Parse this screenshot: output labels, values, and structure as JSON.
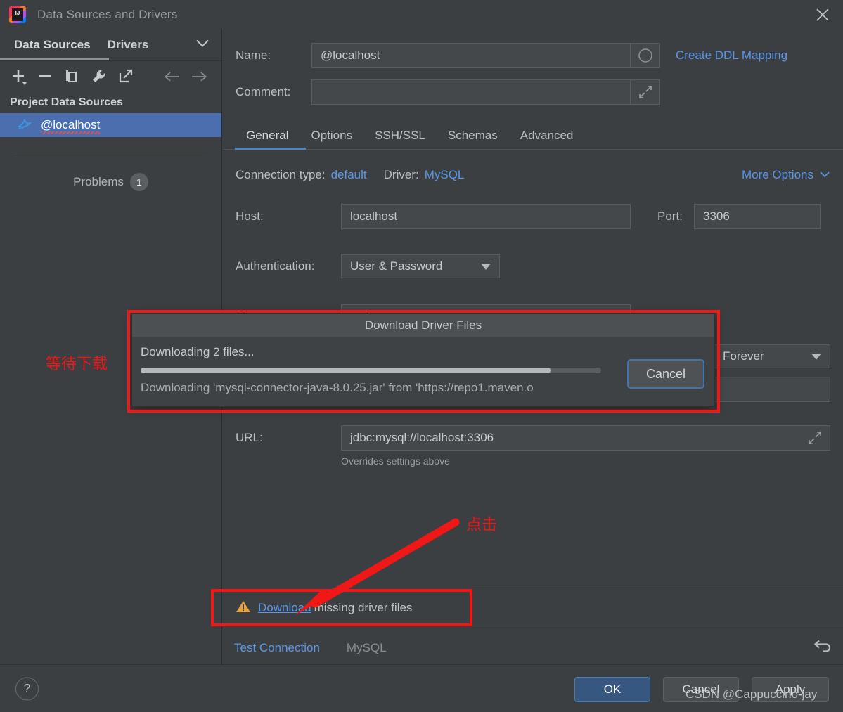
{
  "window": {
    "title": "Data Sources and Drivers",
    "logo_icon": "intellij-idea-logo",
    "close_icon": "close-icon"
  },
  "sidebar": {
    "tabs": [
      {
        "label": "Data Sources",
        "active": true
      },
      {
        "label": "Drivers",
        "active": false
      }
    ],
    "expand_icon": "chevron-down-icon",
    "toolbar": [
      {
        "icon": "add-icon",
        "label": "Add"
      },
      {
        "icon": "remove-icon",
        "label": "Remove"
      },
      {
        "icon": "copy-icon",
        "label": "Duplicate"
      },
      {
        "icon": "wrench-icon",
        "label": "Properties"
      },
      {
        "icon": "external-link-icon",
        "label": "Open"
      },
      {
        "icon": "arrow-left-icon",
        "label": "Back"
      },
      {
        "icon": "arrow-right-icon",
        "label": "Forward"
      }
    ],
    "section_title": "Project Data Sources",
    "data_source": {
      "label": "@localhost",
      "icon": "mysql-dolphin-icon",
      "selected": true
    },
    "problems": {
      "label": "Problems",
      "count": "1"
    }
  },
  "main": {
    "name": {
      "label": "Name:",
      "value": "@localhost",
      "color_icon": "color-circle-icon"
    },
    "comment": {
      "label": "Comment:",
      "value": "",
      "expand_icon": "expand-icon"
    },
    "create_ddl_mapping": "Create DDL Mapping",
    "tabs": [
      {
        "label": "General",
        "active": true
      },
      {
        "label": "Options",
        "active": false
      },
      {
        "label": "SSH/SSL",
        "active": false
      },
      {
        "label": "Schemas",
        "active": false
      },
      {
        "label": "Advanced",
        "active": false
      }
    ],
    "connection_type": {
      "label": "Connection type:",
      "value": "default"
    },
    "driver": {
      "label": "Driver:",
      "value": "MySQL"
    },
    "more_options": {
      "label": "More Options",
      "icon": "chevron-down-icon"
    },
    "host": {
      "label": "Host:",
      "value": "localhost"
    },
    "port": {
      "label": "Port:",
      "value": "3306"
    },
    "authentication": {
      "label": "Authentication:",
      "value": "User & Password",
      "caret_icon": "caret-down-icon"
    },
    "user": {
      "label": "User:",
      "value": "root"
    },
    "save": {
      "value": "Forever",
      "caret_icon": "caret-down-icon"
    },
    "password": {
      "value": ""
    },
    "url": {
      "label": "URL:",
      "value": "jdbc:mysql://localhost:3306",
      "expand_icon": "expand-icon",
      "hint": "Overrides settings above"
    },
    "driver_warning": {
      "icon": "warning-triangle-icon",
      "link_text": "Download",
      "rest_text": " missing driver files"
    },
    "test_connection": "Test Connection",
    "driver_name": "MySQL",
    "revert_icon": "revert-arrow-icon"
  },
  "download_dialog": {
    "title": "Download Driver Files",
    "status": "Downloading 2 files...",
    "progress_percent": 89,
    "detail": "Downloading 'mysql-connector-java-8.0.25.jar' from 'https://repo1.maven.o",
    "cancel_label": "Cancel"
  },
  "footer": {
    "help_icon": "question-mark-icon",
    "ok_label": "OK",
    "cancel_label": "Cancel",
    "apply_label": "Apply"
  },
  "annotations": {
    "wait_download": "等待下载",
    "click": "点击",
    "arrow_icon": "red-arrow-icon",
    "box_color": "#f01717"
  },
  "watermark": "CSDN @Cappuccino-jay"
}
